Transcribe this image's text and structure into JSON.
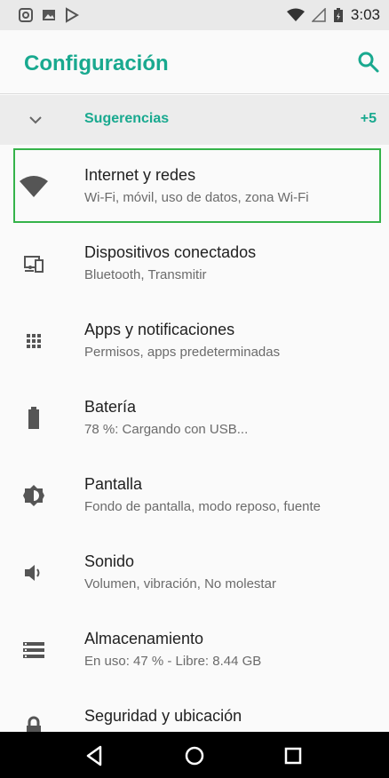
{
  "status_bar": {
    "time": "3:03"
  },
  "app_bar": {
    "title": "Configuración"
  },
  "suggestions": {
    "label": "Sugerencias",
    "count": "+5"
  },
  "items": [
    {
      "title": "Internet y redes",
      "subtitle": "Wi-Fi, móvil, uso de datos, zona Wi-Fi",
      "icon": "wifi-icon"
    },
    {
      "title": "Dispositivos conectados",
      "subtitle": "Bluetooth, Transmitir",
      "icon": "devices-icon"
    },
    {
      "title": "Apps y notificaciones",
      "subtitle": "Permisos, apps predeterminadas",
      "icon": "apps-grid-icon"
    },
    {
      "title": "Batería",
      "subtitle": "78 %: Cargando con USB...",
      "icon": "battery-icon"
    },
    {
      "title": "Pantalla",
      "subtitle": "Fondo de pantalla, modo reposo, fuente",
      "icon": "brightness-icon"
    },
    {
      "title": "Sonido",
      "subtitle": "Volumen, vibración, No molestar",
      "icon": "volume-icon"
    },
    {
      "title": "Almacenamiento",
      "subtitle": "En uso: 47 % - Libre: 8.44 GB",
      "icon": "storage-icon"
    },
    {
      "title": "Seguridad y ubicación",
      "subtitle": "",
      "icon": "lock-icon"
    }
  ],
  "colors": {
    "accent": "#19a98f",
    "highlight": "#35b34a",
    "icon": "#555555"
  }
}
